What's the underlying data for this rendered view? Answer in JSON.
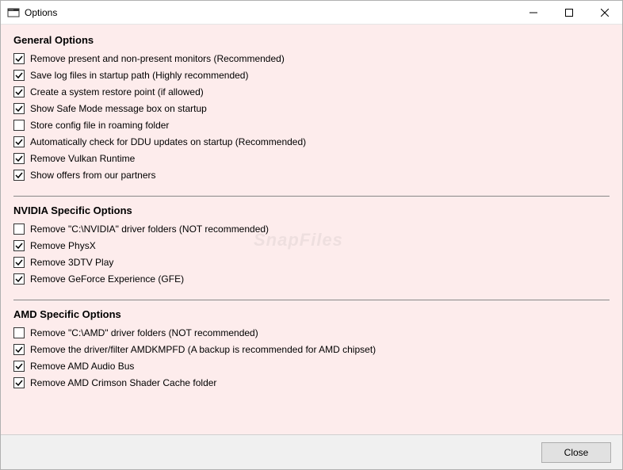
{
  "window": {
    "title": "Options"
  },
  "sections": {
    "general": {
      "heading": "General Options",
      "options": [
        {
          "label": "Remove present and non-present monitors (Recommended)",
          "checked": true
        },
        {
          "label": "Save log files in startup path (Highly recommended)",
          "checked": true
        },
        {
          "label": "Create a system restore point (if allowed)",
          "checked": true
        },
        {
          "label": "Show Safe Mode message box on startup",
          "checked": true
        },
        {
          "label": "Store config file in roaming folder",
          "checked": false
        },
        {
          "label": "Automatically check for DDU updates on startup (Recommended)",
          "checked": true
        },
        {
          "label": "Remove Vulkan Runtime",
          "checked": true
        },
        {
          "label": "Show offers from our partners",
          "checked": true
        }
      ]
    },
    "nvidia": {
      "heading": "NVIDIA Specific Options",
      "options": [
        {
          "label": "Remove \"C:\\NVIDIA\" driver folders (NOT recommended)",
          "checked": false
        },
        {
          "label": "Remove PhysX",
          "checked": true
        },
        {
          "label": "Remove 3DTV Play",
          "checked": true
        },
        {
          "label": "Remove GeForce Experience (GFE)",
          "checked": true
        }
      ]
    },
    "amd": {
      "heading": "AMD Specific Options",
      "options": [
        {
          "label": "Remove \"C:\\AMD\" driver folders (NOT recommended)",
          "checked": false
        },
        {
          "label": "Remove the driver/filter AMDKMPFD (A backup is recommended for AMD chipset)",
          "checked": true
        },
        {
          "label": "Remove AMD Audio Bus",
          "checked": true
        },
        {
          "label": "Remove AMD Crimson Shader Cache folder",
          "checked": true
        }
      ]
    }
  },
  "footer": {
    "close_label": "Close"
  },
  "watermark": {
    "text": "SnapFiles"
  }
}
